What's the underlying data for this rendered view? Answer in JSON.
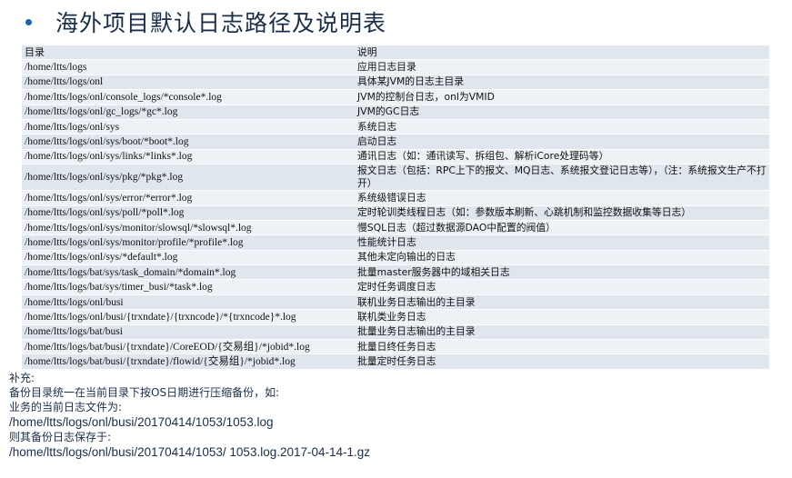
{
  "title": "海外项目默认日志路径及说明表",
  "table": {
    "headers": [
      "目录",
      "说明"
    ],
    "rows": [
      [
        "/home/ltts/logs",
        "应用日志目录"
      ],
      [
        "/home/ltts/logs/onl",
        "具体某JVM的日志主目录"
      ],
      [
        "/home/ltts/logs/onl/console_logs/*console*.log",
        "JVM的控制台日志，onl为VMID"
      ],
      [
        "/home/ltts/logs/onl/gc_logs/*gc*.log",
        "JVM的GC日志"
      ],
      [
        "/home/ltts/logs/onl/sys",
        "系统日志"
      ],
      [
        "/home/ltts/logs/onl/sys/boot/*boot*.log",
        "启动日志"
      ],
      [
        "/home/ltts/logs/onl/sys/links/*links*.log",
        "通讯日志（如：通讯读写、拆组包、解析iCore处理码等）"
      ],
      [
        "/home/ltts/logs/onl/sys/pkg/*pkg*.log",
        "报文日志（包括：RPC上下的报文、MQ日志、系统报文登记日志等），（注：系统报文生产不打开）"
      ],
      [
        "/home/ltts/logs/onl/sys/error/*error*.log",
        "系统级错误日志"
      ],
      [
        "/home/ltts/logs/onl/sys/poll/*poll*.log",
        "定时轮训类线程日志（如：参数版本刷新、心跳机制和监控数据收集等日志）"
      ],
      [
        "/home/ltts/logs/onl/sys/monitor/slowsql/*slowsql*.log",
        "慢SQL日志（超过数据源DAO中配置的阀值）"
      ],
      [
        "/home/ltts/logs/onl/sys/monitor/profile/*profile*.log",
        "性能统计日志"
      ],
      [
        "/home/ltts/logs/onl/sys/*default*.log",
        "其他未定向输出的日志"
      ],
      [
        "/home/ltts/logs/bat/sys/task_domain/*domain*.log",
        "批量master服务器中的域相关日志"
      ],
      [
        "/home/ltts/logs/bat/sys/timer_busi/*task*.log",
        "定时任务调度日志"
      ],
      [
        "/home/ltts/logs/onl/busi",
        "联机业务日志输出的主目录"
      ],
      [
        "/home/ltts/logs/onl/busi/{trxndate}/{trxncode}/*{trxncode}*.log",
        "联机类业务日志"
      ],
      [
        "/home/ltts/logs/bat/busi",
        "批量业务日志输出的主目录"
      ],
      [
        "/home/ltts/logs/bat/busi/{trxndate}/CoreEOD/{交易组}/*jobid*.log",
        "批量日终任务日志"
      ],
      [
        "/home/ltts/logs/bat/busi/{trxndate}/flowid/{交易组}/*jobid*.log",
        "批量定时任务日志"
      ]
    ]
  },
  "supplement": {
    "heading": "补充:",
    "line1": "备份目录统一在当前目录下按OS日期进行压缩备份，如:",
    "line2": "业务的当前日志文件为:",
    "path1": "/home/ltts/logs/onl/busi/20170414/1053/1053.log",
    "line3": "则其备份日志保存于:",
    "path2": "/home/ltts/logs/onl/busi/20170414/1053/ 1053.log.2017-04-14-1.gz"
  }
}
